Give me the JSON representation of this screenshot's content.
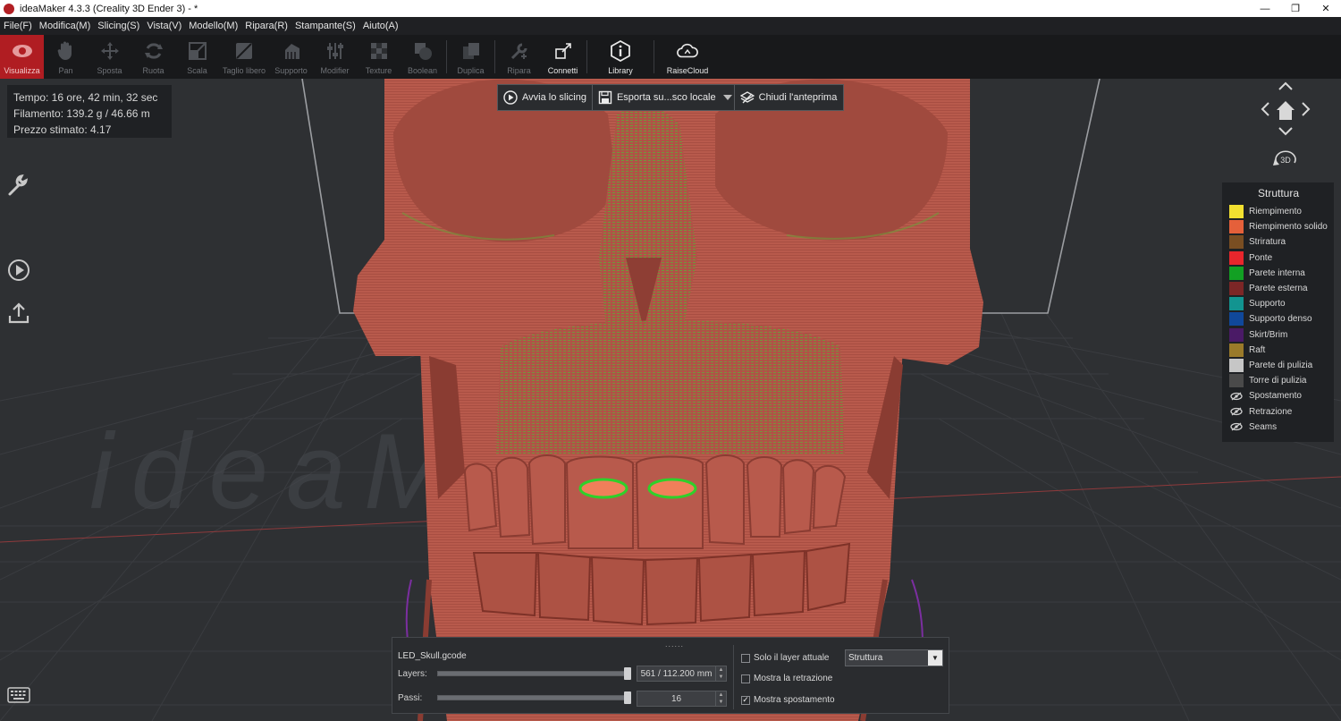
{
  "window": {
    "title": "ideaMaker 4.3.3 (Creality 3D Ender 3) - *",
    "minimize": "—",
    "maximize": "❐",
    "close": "✕"
  },
  "menu": [
    "File(F)",
    "Modifica(M)",
    "Slicing(S)",
    "Vista(V)",
    "Modello(M)",
    "Ripara(R)",
    "Stampante(S)",
    "Aiuto(A)"
  ],
  "toolbar": {
    "items": [
      {
        "label": "Visualizza",
        "icon": "eye-icon"
      },
      {
        "label": "Pan",
        "icon": "hand-icon"
      },
      {
        "label": "Sposta",
        "icon": "move-icon"
      },
      {
        "label": "Ruota",
        "icon": "rotate-icon"
      },
      {
        "label": "Scala",
        "icon": "scale-icon"
      },
      {
        "label": "Taglio libero",
        "icon": "cut-icon"
      },
      {
        "label": "Supporto",
        "icon": "support-icon"
      },
      {
        "label": "Modifier",
        "icon": "modifier-icon"
      },
      {
        "label": "Texture",
        "icon": "texture-icon"
      },
      {
        "label": "Boolean",
        "icon": "boolean-icon"
      },
      {
        "label": "Duplica",
        "icon": "duplicate-icon"
      },
      {
        "label": "Ripara",
        "icon": "repair-icon"
      },
      {
        "label": "Connetti",
        "icon": "connect-icon"
      },
      {
        "label": "Library",
        "icon": "library-icon"
      },
      {
        "label": "RaiseCloud",
        "icon": "cloud-icon"
      }
    ]
  },
  "stats": {
    "time": "Tempo: 16 ore, 42 min, 32 sec",
    "filament": "Filamento: 139.2 g / 46.66 m",
    "price": "Prezzo stimato: 4.17"
  },
  "actions": {
    "slice": "Avvia lo slicing",
    "export": "Esporta su...sco locale",
    "close_preview": "Chiudi l'anteprima"
  },
  "navcube": {
    "label_3d": "3D"
  },
  "watermark": "ideaMaker",
  "legend": {
    "title": "Struttura",
    "items": [
      {
        "label": "Riempimento",
        "color": "#f2e030"
      },
      {
        "label": "Riempimento solido",
        "color": "#e5603a"
      },
      {
        "label": "Striratura",
        "color": "#7a4e22"
      },
      {
        "label": "Ponte",
        "color": "#e8262c"
      },
      {
        "label": "Parete interna",
        "color": "#12a023"
      },
      {
        "label": "Parete esterna",
        "color": "#7c2626"
      },
      {
        "label": "Supporto",
        "color": "#129490"
      },
      {
        "label": "Supporto denso",
        "color": "#10489a"
      },
      {
        "label": "Skirt/Brim",
        "color": "#4a1a66"
      },
      {
        "label": "Raft",
        "color": "#9a7a2a"
      },
      {
        "label": "Parete di pulizia",
        "color": "#c6c6c6"
      },
      {
        "label": "Torre di pulizia",
        "color": "#4a4a4a"
      }
    ],
    "toggles": [
      {
        "label": "Spostamento",
        "icon": "eye-hidden-icon"
      },
      {
        "label": "Retrazione",
        "icon": "eye-hidden-icon"
      },
      {
        "label": "Seams",
        "icon": "eye-hidden-icon"
      }
    ]
  },
  "preview": {
    "grip": "......",
    "filename": "LED_Skull.gcode",
    "layers_label": "Layers:",
    "layers_value": "561 / 112.200 mm",
    "layers_position": 1.0,
    "steps_label": "Passi:",
    "steps_value": "16",
    "steps_position": 1.0,
    "only_current_layer": "Solo il layer attuale",
    "show_retraction": "Mostra la retrazione",
    "show_travel": "Mostra spostamento",
    "only_current_checked": false,
    "retraction_checked": false,
    "travel_checked": true,
    "view_mode": "Struttura"
  }
}
